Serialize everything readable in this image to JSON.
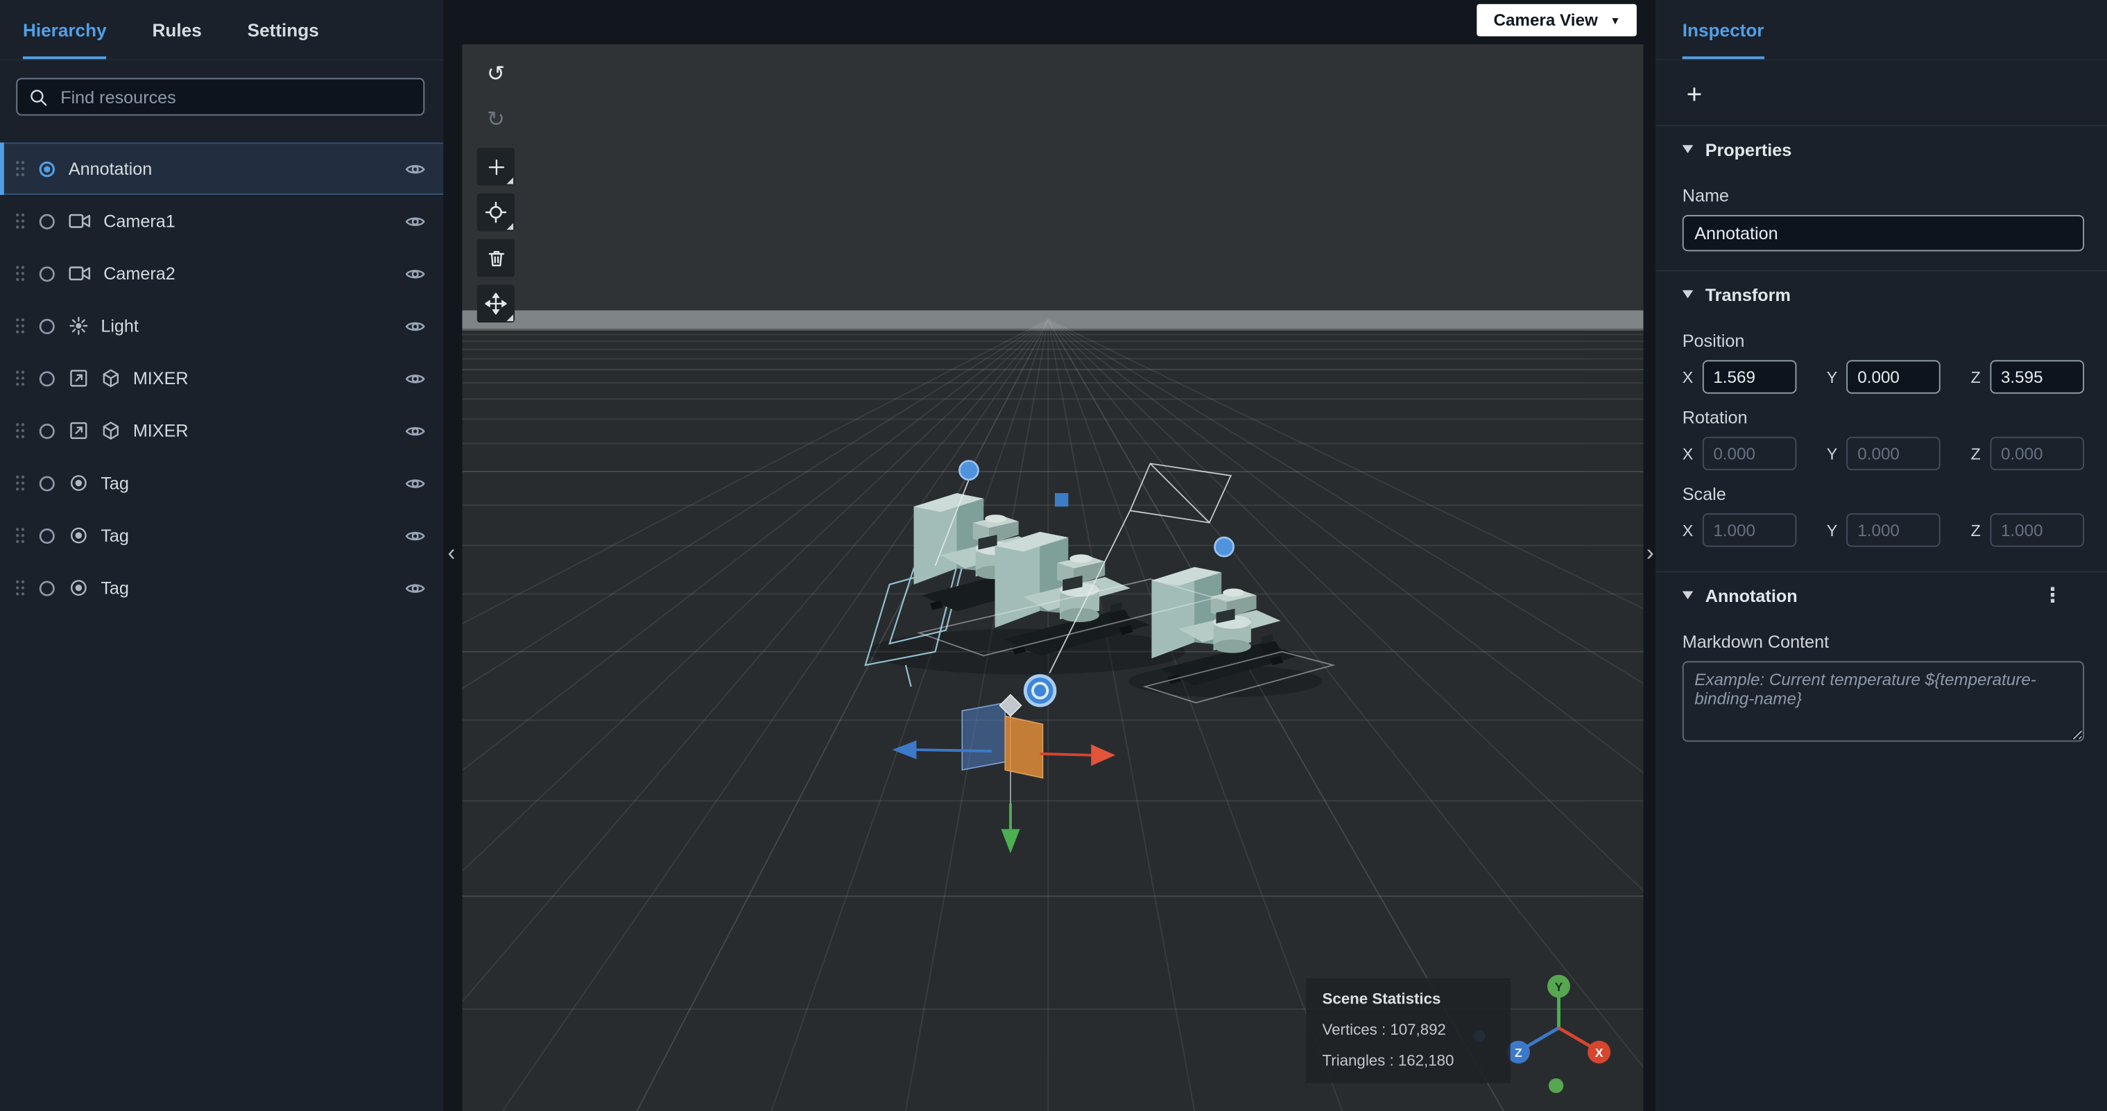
{
  "colors": {
    "accent": "#539fe5",
    "axis_x": "#d6452e",
    "axis_y": "#56a74f",
    "axis_z": "#3d79c9",
    "panel_bg": "#1a212b",
    "viewport_bg": "#2a2d2f"
  },
  "left_panel": {
    "tabs": [
      {
        "label": "Hierarchy",
        "active": true
      },
      {
        "label": "Rules",
        "active": false
      },
      {
        "label": "Settings",
        "active": false
      }
    ],
    "search_placeholder": "Find resources",
    "tree": [
      {
        "label": "Annotation",
        "icon": "annotation-selected-radio",
        "selected": true
      },
      {
        "label": "Camera1",
        "icon": "camera-icon",
        "selected": false
      },
      {
        "label": "Camera2",
        "icon": "camera-icon",
        "selected": false
      },
      {
        "label": "Light",
        "icon": "light-icon",
        "selected": false
      },
      {
        "label": "MIXER",
        "icon": "model-icon cube-icon",
        "selected": false
      },
      {
        "label": "MIXER",
        "icon": "model-icon cube-icon",
        "selected": false
      },
      {
        "label": "Tag",
        "icon": "tag-icon",
        "selected": false
      },
      {
        "label": "Tag",
        "icon": "tag-icon",
        "selected": false
      },
      {
        "label": "Tag",
        "icon": "tag-icon",
        "selected": false
      }
    ]
  },
  "viewport": {
    "camera_view": {
      "label": "Camera View",
      "caret": "▼"
    },
    "toolbar": {
      "buttons": [
        "undo",
        "redo",
        "add-object",
        "transform-target",
        "delete",
        "move"
      ],
      "undo_glyph": "↺",
      "redo_glyph": "↻"
    },
    "stats": {
      "title": "Scene Statistics",
      "vertices": "Vertices : 107,892",
      "triangles": "Triangles : 162,180"
    },
    "axis_widget": {
      "x": "X",
      "y": "Y",
      "z": "Z"
    }
  },
  "inspector": {
    "tab": "Inspector",
    "add_button": "+",
    "properties": {
      "title": "Properties",
      "name_label": "Name",
      "name_value": "Annotation"
    },
    "transform": {
      "title": "Transform",
      "axes": [
        "X",
        "Y",
        "Z"
      ],
      "position": {
        "label": "Position",
        "x": "1.569",
        "y": "0.000",
        "z": "3.595"
      },
      "rotation": {
        "label": "Rotation",
        "x": "0.000",
        "y": "0.000",
        "z": "0.000"
      },
      "scale": {
        "label": "Scale",
        "x": "1.000",
        "y": "1.000",
        "z": "1.000"
      }
    },
    "annotation": {
      "title": "Annotation",
      "kebab": "⋮",
      "markdown_label": "Markdown Content",
      "markdown_placeholder": "Example: Current temperature ${temperature-binding-name}"
    }
  }
}
